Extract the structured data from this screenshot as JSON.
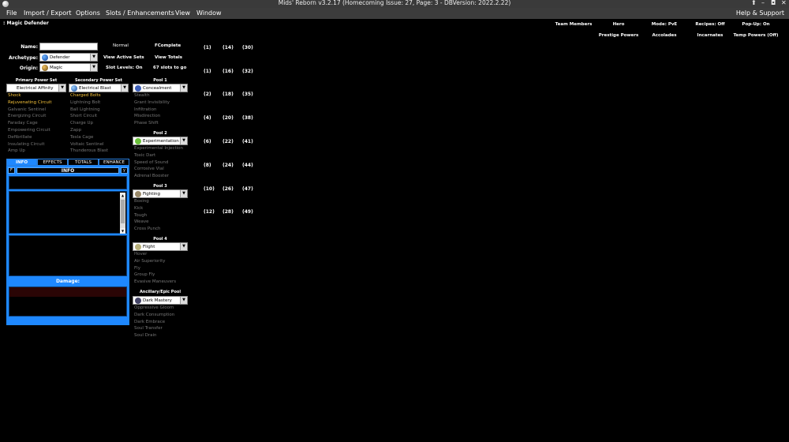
{
  "window": {
    "title": "Mids' Reborn v3.2.17  (Homecoming Issue: 27, Page: 3 - DBVersion: 2022.2.22)",
    "controls": [
      "⬆",
      "–",
      "◘",
      "✕"
    ]
  },
  "menu": {
    "items": [
      "File",
      "Import / Export",
      "Options",
      "Slots / Enhancements",
      "View",
      "Window"
    ],
    "help": "Help & Support"
  },
  "character_title": ": Magic Defender",
  "header": {
    "team_members": "Team Members",
    "alignment": "Hero",
    "mode": "Mode: PvE",
    "recipes": "Recipes: Off",
    "popup": "Pop-Up: On",
    "prestige": "Prestige Powers",
    "accolades": "Accolades",
    "incarnates": "Incarnates",
    "temp_powers": "Temp Powers (Off)"
  },
  "form": {
    "name_label": "Name:",
    "name_value": "",
    "archetype_label": "Archetype:",
    "archetype_value": "Defender",
    "origin_label": "Origin:",
    "origin_value": "Magic",
    "view_active_sets": "View Active Sets",
    "view_totals": "View Totals",
    "slot_levels": "Slot Levels: On",
    "slots_to_go": "67 slots to go",
    "normal": "Normal",
    "complete": "FComplete"
  },
  "primary": {
    "header": "Primary Power Set",
    "set": "Electrical Affinity",
    "powers": [
      {
        "name": "Shock",
        "taken": true
      },
      {
        "name": "Rejuvenating Circuit",
        "taken": true
      },
      {
        "name": "Galvanic Sentinel",
        "taken": false
      },
      {
        "name": "Energizing Circuit",
        "taken": false
      },
      {
        "name": "Faraday Cage",
        "taken": false
      },
      {
        "name": "Empowering Circuit",
        "taken": false
      },
      {
        "name": "Defibrillate",
        "taken": false
      },
      {
        "name": "Insulating Circuit",
        "taken": false
      },
      {
        "name": "Amp Up",
        "taken": false
      }
    ]
  },
  "secondary": {
    "header": "Secondary Power Set",
    "set": "Electrical Blast",
    "powers": [
      {
        "name": "Charged Bolts",
        "taken": true
      },
      {
        "name": "Lightning Bolt",
        "taken": false
      },
      {
        "name": "Ball Lightning",
        "taken": false
      },
      {
        "name": "Short Circuit",
        "taken": false
      },
      {
        "name": "Charge Up",
        "taken": false
      },
      {
        "name": "Zapp",
        "taken": false
      },
      {
        "name": "Tesla Cage",
        "taken": false
      },
      {
        "name": "Voltaic Sentinel",
        "taken": false
      },
      {
        "name": "Thunderous Blast",
        "taken": false
      }
    ]
  },
  "pools": [
    {
      "header": "Pool 1",
      "set": "Concealment",
      "icon_color": "#3d5fb8",
      "powers": [
        "Stealth",
        "Grant Invisibility",
        "Infiltration",
        "Misdirection",
        "Phase Shift"
      ]
    },
    {
      "header": "Pool 2",
      "set": "Experimentation",
      "icon_color": "#6ac03a",
      "powers": [
        "Experimental Injection",
        "Toxic Dart",
        "Speed of Sound",
        "Corrosive Vial",
        "Adrenal Booster"
      ]
    },
    {
      "header": "Pool 3",
      "set": "Fighting",
      "icon_color": "#9a8a6a",
      "powers": [
        "Boxing",
        "Kick",
        "Tough",
        "Weave",
        "Cross Punch"
      ]
    },
    {
      "header": "Pool 4",
      "set": "Flight",
      "icon_color": "#b8b07a",
      "powers": [
        "Hover",
        "Air Superiority",
        "Fly",
        "Group Fly",
        "Evasive Maneuvers"
      ]
    },
    {
      "header": "Ancillary/Epic Pool",
      "set": "Dark Mastery",
      "icon_color": "#444466",
      "powers": [
        "Oppressive Gloom",
        "Dark Consumption",
        "Dark Embrace",
        "Soul Transfer",
        "Soul Drain"
      ]
    }
  ],
  "info_panel": {
    "tabs": [
      "INFO",
      "EFFECTS",
      "TOTALS",
      "ENHANCE"
    ],
    "left_btn": "F",
    "right_btn": "y",
    "title": "INFO",
    "damage_label": "Damage:"
  },
  "levels": [
    [
      "(1)",
      "(14)",
      "(30)"
    ],
    [
      "(1)",
      "(16)",
      "(32)"
    ],
    [
      "(2)",
      "(18)",
      "(35)"
    ],
    [
      "(4)",
      "(20)",
      "(38)"
    ],
    [
      "(6)",
      "(22)",
      "(41)"
    ],
    [
      "(8)",
      "(24)",
      "(44)"
    ],
    [
      "(10)",
      "(26)",
      "(47)"
    ],
    [
      "(12)",
      "(28)",
      "(49)"
    ]
  ],
  "colors": {
    "accent": "#1e88ff",
    "taken": "#f5c23a",
    "untaken": "#777777",
    "menubar": "#3c3c3c"
  }
}
